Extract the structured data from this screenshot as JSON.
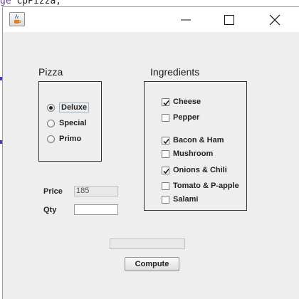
{
  "background_code": {
    "keyword_fragment": "ge",
    "code_fragment": " cpPizza;"
  },
  "window": {
    "title": "",
    "controls": [
      "minimize",
      "maximize",
      "close"
    ]
  },
  "pizza": {
    "title": "Pizza",
    "options": [
      {
        "label": "Deluxe",
        "selected": true
      },
      {
        "label": "Special",
        "selected": false
      },
      {
        "label": "Primo",
        "selected": false
      }
    ]
  },
  "ingredients": {
    "title": "Ingredients",
    "items": [
      {
        "label": "Cheese",
        "checked": true
      },
      {
        "label": "Pepper",
        "checked": false
      },
      {
        "label": "Bacon & Ham",
        "checked": true
      },
      {
        "label": "Mushroom",
        "checked": false
      },
      {
        "label": "Onions & Chili",
        "checked": true
      },
      {
        "label": "Tomato & P-apple",
        "checked": false
      },
      {
        "label": "Salami",
        "checked": false
      }
    ]
  },
  "price": {
    "label": "Price",
    "value": "185"
  },
  "qty": {
    "label": "Qty",
    "value": ""
  },
  "result": {
    "value": ""
  },
  "compute_button": {
    "label": "Compute"
  },
  "colors": {
    "window_bg": "#eeeeee",
    "titlebar_bg": "#ffffff",
    "border": "#333333"
  }
}
